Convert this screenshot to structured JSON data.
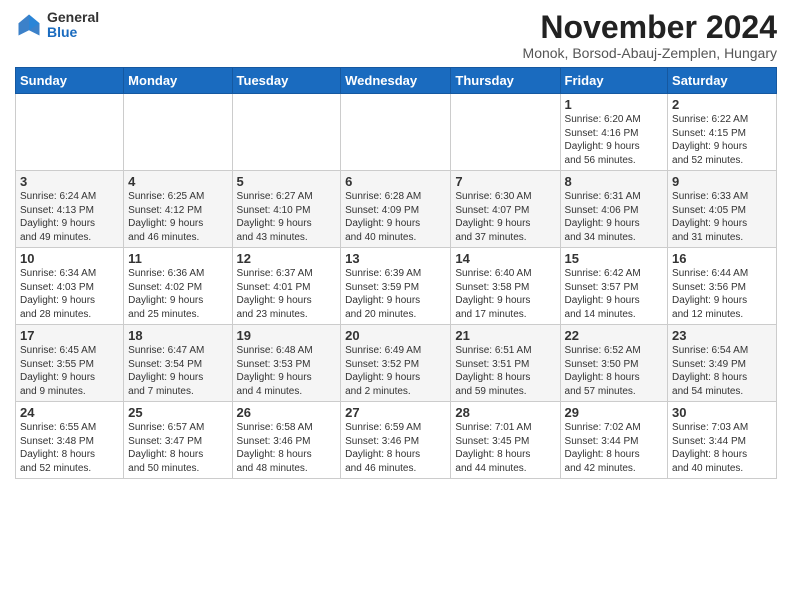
{
  "logo": {
    "general": "General",
    "blue": "Blue"
  },
  "title": "November 2024",
  "location": "Monok, Borsod-Abauj-Zemplen, Hungary",
  "headers": [
    "Sunday",
    "Monday",
    "Tuesday",
    "Wednesday",
    "Thursday",
    "Friday",
    "Saturday"
  ],
  "weeks": [
    [
      {
        "day": "",
        "info": ""
      },
      {
        "day": "",
        "info": ""
      },
      {
        "day": "",
        "info": ""
      },
      {
        "day": "",
        "info": ""
      },
      {
        "day": "",
        "info": ""
      },
      {
        "day": "1",
        "info": "Sunrise: 6:20 AM\nSunset: 4:16 PM\nDaylight: 9 hours\nand 56 minutes."
      },
      {
        "day": "2",
        "info": "Sunrise: 6:22 AM\nSunset: 4:15 PM\nDaylight: 9 hours\nand 52 minutes."
      }
    ],
    [
      {
        "day": "3",
        "info": "Sunrise: 6:24 AM\nSunset: 4:13 PM\nDaylight: 9 hours\nand 49 minutes."
      },
      {
        "day": "4",
        "info": "Sunrise: 6:25 AM\nSunset: 4:12 PM\nDaylight: 9 hours\nand 46 minutes."
      },
      {
        "day": "5",
        "info": "Sunrise: 6:27 AM\nSunset: 4:10 PM\nDaylight: 9 hours\nand 43 minutes."
      },
      {
        "day": "6",
        "info": "Sunrise: 6:28 AM\nSunset: 4:09 PM\nDaylight: 9 hours\nand 40 minutes."
      },
      {
        "day": "7",
        "info": "Sunrise: 6:30 AM\nSunset: 4:07 PM\nDaylight: 9 hours\nand 37 minutes."
      },
      {
        "day": "8",
        "info": "Sunrise: 6:31 AM\nSunset: 4:06 PM\nDaylight: 9 hours\nand 34 minutes."
      },
      {
        "day": "9",
        "info": "Sunrise: 6:33 AM\nSunset: 4:05 PM\nDaylight: 9 hours\nand 31 minutes."
      }
    ],
    [
      {
        "day": "10",
        "info": "Sunrise: 6:34 AM\nSunset: 4:03 PM\nDaylight: 9 hours\nand 28 minutes."
      },
      {
        "day": "11",
        "info": "Sunrise: 6:36 AM\nSunset: 4:02 PM\nDaylight: 9 hours\nand 25 minutes."
      },
      {
        "day": "12",
        "info": "Sunrise: 6:37 AM\nSunset: 4:01 PM\nDaylight: 9 hours\nand 23 minutes."
      },
      {
        "day": "13",
        "info": "Sunrise: 6:39 AM\nSunset: 3:59 PM\nDaylight: 9 hours\nand 20 minutes."
      },
      {
        "day": "14",
        "info": "Sunrise: 6:40 AM\nSunset: 3:58 PM\nDaylight: 9 hours\nand 17 minutes."
      },
      {
        "day": "15",
        "info": "Sunrise: 6:42 AM\nSunset: 3:57 PM\nDaylight: 9 hours\nand 14 minutes."
      },
      {
        "day": "16",
        "info": "Sunrise: 6:44 AM\nSunset: 3:56 PM\nDaylight: 9 hours\nand 12 minutes."
      }
    ],
    [
      {
        "day": "17",
        "info": "Sunrise: 6:45 AM\nSunset: 3:55 PM\nDaylight: 9 hours\nand 9 minutes."
      },
      {
        "day": "18",
        "info": "Sunrise: 6:47 AM\nSunset: 3:54 PM\nDaylight: 9 hours\nand 7 minutes."
      },
      {
        "day": "19",
        "info": "Sunrise: 6:48 AM\nSunset: 3:53 PM\nDaylight: 9 hours\nand 4 minutes."
      },
      {
        "day": "20",
        "info": "Sunrise: 6:49 AM\nSunset: 3:52 PM\nDaylight: 9 hours\nand 2 minutes."
      },
      {
        "day": "21",
        "info": "Sunrise: 6:51 AM\nSunset: 3:51 PM\nDaylight: 8 hours\nand 59 minutes."
      },
      {
        "day": "22",
        "info": "Sunrise: 6:52 AM\nSunset: 3:50 PM\nDaylight: 8 hours\nand 57 minutes."
      },
      {
        "day": "23",
        "info": "Sunrise: 6:54 AM\nSunset: 3:49 PM\nDaylight: 8 hours\nand 54 minutes."
      }
    ],
    [
      {
        "day": "24",
        "info": "Sunrise: 6:55 AM\nSunset: 3:48 PM\nDaylight: 8 hours\nand 52 minutes."
      },
      {
        "day": "25",
        "info": "Sunrise: 6:57 AM\nSunset: 3:47 PM\nDaylight: 8 hours\nand 50 minutes."
      },
      {
        "day": "26",
        "info": "Sunrise: 6:58 AM\nSunset: 3:46 PM\nDaylight: 8 hours\nand 48 minutes."
      },
      {
        "day": "27",
        "info": "Sunrise: 6:59 AM\nSunset: 3:46 PM\nDaylight: 8 hours\nand 46 minutes."
      },
      {
        "day": "28",
        "info": "Sunrise: 7:01 AM\nSunset: 3:45 PM\nDaylight: 8 hours\nand 44 minutes."
      },
      {
        "day": "29",
        "info": "Sunrise: 7:02 AM\nSunset: 3:44 PM\nDaylight: 8 hours\nand 42 minutes."
      },
      {
        "day": "30",
        "info": "Sunrise: 7:03 AM\nSunset: 3:44 PM\nDaylight: 8 hours\nand 40 minutes."
      }
    ]
  ]
}
